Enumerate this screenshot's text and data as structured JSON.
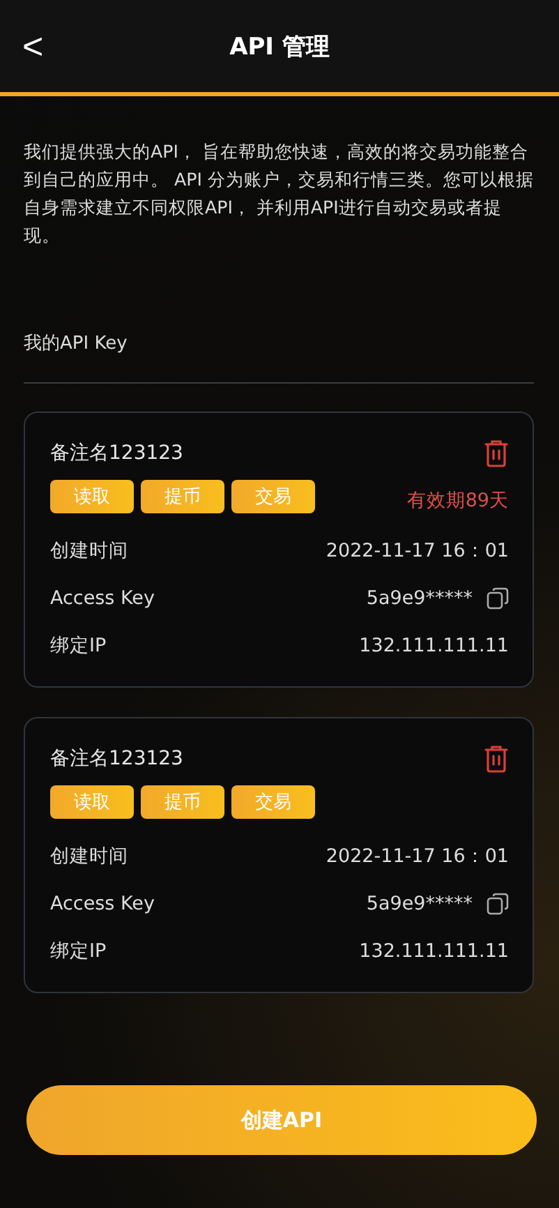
{
  "header": {
    "back": "<",
    "title": "API 管理"
  },
  "intro": "我们提供强大的API， 旨在帮助您快速，高效的将交易功能整合到自己的应用中。 API 分为账户，交易和行情三类。您可以根据自身需求建立不同权限API， 并利用API进行自动交易或者提现。",
  "section_title": "我的API Key",
  "keys": [
    {
      "name": "备注名123123",
      "permissions": [
        "读取",
        "提币",
        "交易"
      ],
      "expiry": "有效期89天",
      "rows": [
        {
          "label": "创建时间",
          "value": "2022-11-17 16：01",
          "copyable": false
        },
        {
          "label": "Access Key",
          "value": "5a9e9*****",
          "copyable": true
        },
        {
          "label": "绑定IP",
          "value": "132.111.111.11",
          "copyable": false
        }
      ]
    },
    {
      "name": "备注名123123",
      "permissions": [
        "读取",
        "提币",
        "交易"
      ],
      "rows": [
        {
          "label": "创建时间",
          "value": "2022-11-17 16：01",
          "copyable": false
        },
        {
          "label": "Access Key",
          "value": "5a9e9*****",
          "copyable": true
        },
        {
          "label": "绑定IP",
          "value": "132.111.111.11",
          "copyable": false
        }
      ]
    }
  ],
  "create_button": "创建API"
}
